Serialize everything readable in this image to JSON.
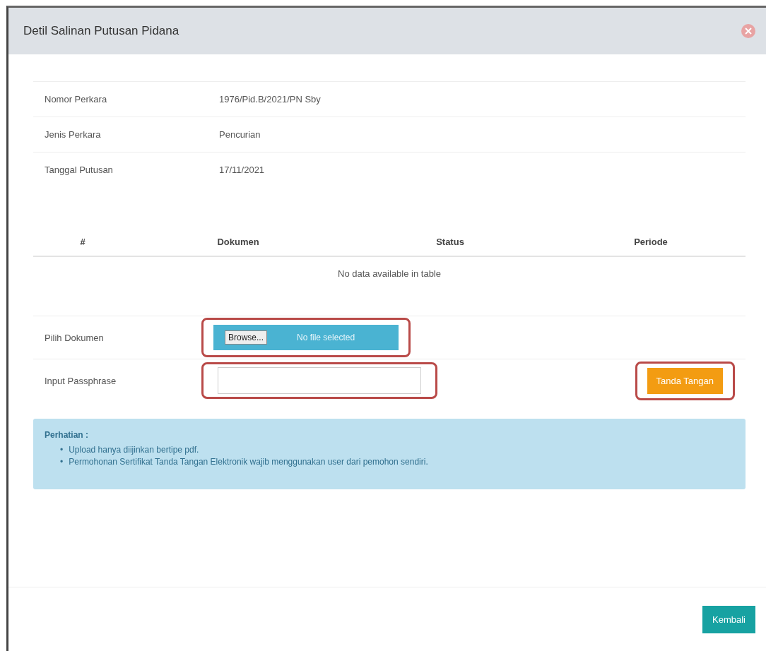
{
  "dialog": {
    "title": "Detil Salinan Putusan Pidana"
  },
  "details": [
    {
      "label": "Nomor Perkara",
      "value": "1976/Pid.B/2021/PN Sby"
    },
    {
      "label": "Jenis Perkara",
      "value": "Pencurian"
    },
    {
      "label": "Tanggal Putusan",
      "value": "17/11/2021"
    }
  ],
  "documents_table": {
    "columns": [
      "#",
      "Dokumen",
      "Status",
      "Periode"
    ],
    "empty_message": "No data available in table"
  },
  "form": {
    "file_label": "Pilih Dokumen",
    "browse_button": "Browse...",
    "file_status": "No file selected",
    "passphrase_label": "Input Passphrase",
    "sign_button": "Tanda Tangan"
  },
  "notice": {
    "title": "Perhatian :",
    "items": [
      {
        "bullet": "•",
        "text": "Upload hanya diijinkan bertipe pdf."
      },
      {
        "bullet": "•",
        "text": "Permohonan Sertifikat Tanda Tangan Elektronik wajib menggunakan user dari pemohon sendiri."
      }
    ]
  },
  "footer": {
    "back_button": "Kembali"
  }
}
